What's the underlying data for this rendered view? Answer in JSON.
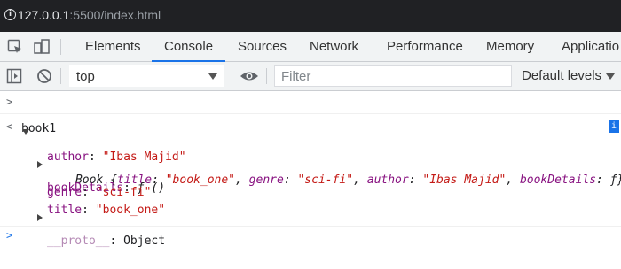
{
  "address_bar": {
    "host": "127.0.0.1",
    "rest": ":5500/index.html"
  },
  "tabs": [
    {
      "label": "Elements"
    },
    {
      "label": "Console",
      "active": true
    },
    {
      "label": "Sources"
    },
    {
      "label": "Network"
    },
    {
      "label": "Performance"
    },
    {
      "label": "Memory"
    },
    {
      "label": "Applicatio"
    }
  ],
  "console_toolbar": {
    "context": "top",
    "filter_placeholder": "Filter",
    "levels": "Default levels"
  },
  "console": {
    "input_line": "book1",
    "object_summary": {
      "type": "Book",
      "open_brace": " {",
      "k1": "title",
      "v1": "\"book_one\"",
      "k2": "genre",
      "v2": "\"sci-fi\"",
      "k3": "author",
      "v3": "\"Ibas Majid\"",
      "k4": "bookDetails",
      "v4": "ƒ",
      "close": "}"
    },
    "properties": [
      {
        "key": "author",
        "value": "\"Ibas Majid\"",
        "expandable": false
      },
      {
        "key": "bookDetails",
        "value": "ƒ ()",
        "expandable": true
      },
      {
        "key": "genre",
        "value": "\"sci-fi\"",
        "expandable": false
      },
      {
        "key": "title",
        "value": "\"book_one\"",
        "expandable": false
      },
      {
        "key": "__proto__",
        "value": "Object",
        "expandable": true
      }
    ]
  },
  "accent": "#1a73e8"
}
